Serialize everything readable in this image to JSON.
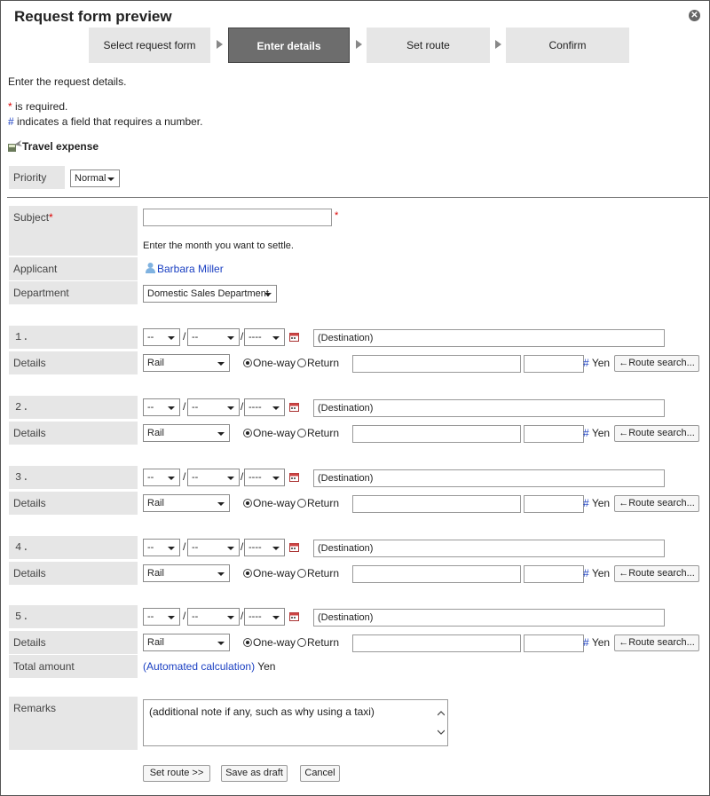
{
  "dialog": {
    "title": "Request form preview"
  },
  "steps": [
    {
      "label": "Select request form",
      "active": false
    },
    {
      "label": "Enter details",
      "active": true
    },
    {
      "label": "Set route",
      "active": false
    },
    {
      "label": "Confirm",
      "active": false
    }
  ],
  "intro": "Enter the request details.",
  "legend": {
    "required_mark": "*",
    "required_text": " is required.",
    "number_mark": "#",
    "number_text": " indicates a field that requires a number."
  },
  "form_title": "Travel expense",
  "priority": {
    "label": "Priority",
    "value": "Normal"
  },
  "subject": {
    "label": "Subject",
    "required_mark": "*",
    "value": "",
    "hint": "Enter the month you want to settle."
  },
  "applicant": {
    "label": "Applicant",
    "name": "Barbara Miller"
  },
  "department": {
    "label": "Department",
    "value": "Domestic Sales Department"
  },
  "trips": [
    {
      "number": "1.",
      "month": "--",
      "day": "--",
      "year": "----",
      "destination": "(Destination)",
      "details_label": "Details",
      "transport": "Rail",
      "one_way": "One-way",
      "return": "Return",
      "number_mark": "#",
      "currency": "Yen",
      "route_button": "←Route search..."
    },
    {
      "number": "2.",
      "month": "--",
      "day": "--",
      "year": "----",
      "destination": "(Destination)",
      "details_label": "Details",
      "transport": "Rail",
      "one_way": "One-way",
      "return": "Return",
      "number_mark": "#",
      "currency": "Yen",
      "route_button": "←Route search..."
    },
    {
      "number": "3.",
      "month": "--",
      "day": "--",
      "year": "----",
      "destination": "(Destination)",
      "details_label": "Details",
      "transport": "Rail",
      "one_way": "One-way",
      "return": "Return",
      "number_mark": "#",
      "currency": "Yen",
      "route_button": "←Route search..."
    },
    {
      "number": "4.",
      "month": "--",
      "day": "--",
      "year": "----",
      "destination": "(Destination)",
      "details_label": "Details",
      "transport": "Rail",
      "one_way": "One-way",
      "return": "Return",
      "number_mark": "#",
      "currency": "Yen",
      "route_button": "←Route search..."
    },
    {
      "number": "5.",
      "month": "--",
      "day": "--",
      "year": "----",
      "destination": "(Destination)",
      "details_label": "Details",
      "transport": "Rail",
      "one_way": "One-way",
      "return": "Return",
      "number_mark": "#",
      "currency": "Yen",
      "route_button": "←Route search..."
    }
  ],
  "date_separator": "/",
  "total": {
    "label": "Total amount",
    "value": "(Automated calculation)",
    "currency": "Yen"
  },
  "remarks": {
    "label": "Remarks",
    "value": "(additional note if any, such as why using a taxi)"
  },
  "buttons": {
    "set_route": "Set route >>",
    "save_draft": "Save as draft",
    "cancel": "Cancel"
  },
  "close_glyph": "✕",
  "colors": {
    "required": "#dd0000",
    "number_mark": "#1a3fc2",
    "link": "#1a3fc2",
    "active_step": "#6d6d6d",
    "label_bg": "#e6e6e6"
  }
}
